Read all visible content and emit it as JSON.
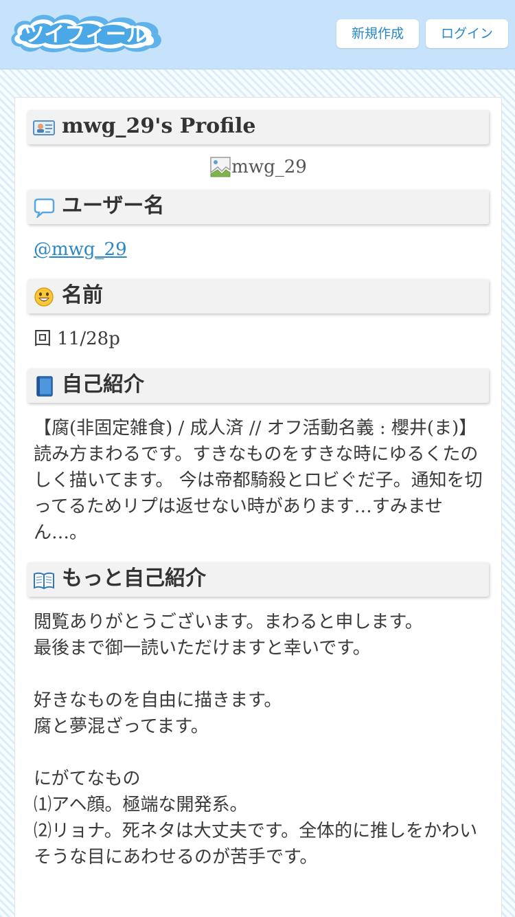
{
  "header": {
    "logo_text": "ツイフィール",
    "new_button": "新規作成",
    "login_button": "ログイン"
  },
  "profile": {
    "title": "mwg_29's Profile",
    "avatar_alt": "mwg_29",
    "username_heading": "ユーザー名",
    "username": "@mwg_29",
    "name_heading": "名前",
    "name": "回 11/28p",
    "bio_heading": "自己紹介",
    "bio": "【腐(非固定雑食) / 成人済 // オフ活動名義 : 櫻井(ま)】読み方まわるです。すきなものをすきな時にゆるくたのしく描いてます。 今は帝都騎殺とロビぐだ子。通知を切ってるためリプは返せない時があります…すみません…。",
    "more_heading": "もっと自己紹介",
    "more_text": "閲覧ありがとうございます。まわると申します。\n最後まで御一読いただけますと幸いです。\n\n好きなものを自由に描きます。\n腐と夢混ざってます。\n\nにがてなもの\n⑴アヘ顔。極端な開発系。\n⑵リョナ。死ネタは大丈夫です。全体的に推しをかわいそうな目にあわせるのが苦手です。"
  },
  "colors": {
    "header_bg": "#c6e3fb",
    "accent": "#2a87c7",
    "heading_bg": "#f2f2f2"
  },
  "icons": [
    "logo-cloud",
    "profile-card-icon",
    "speech-bubble-icon",
    "smile-face-icon",
    "blue-book-icon",
    "open-book-icon",
    "broken-image-icon"
  ]
}
